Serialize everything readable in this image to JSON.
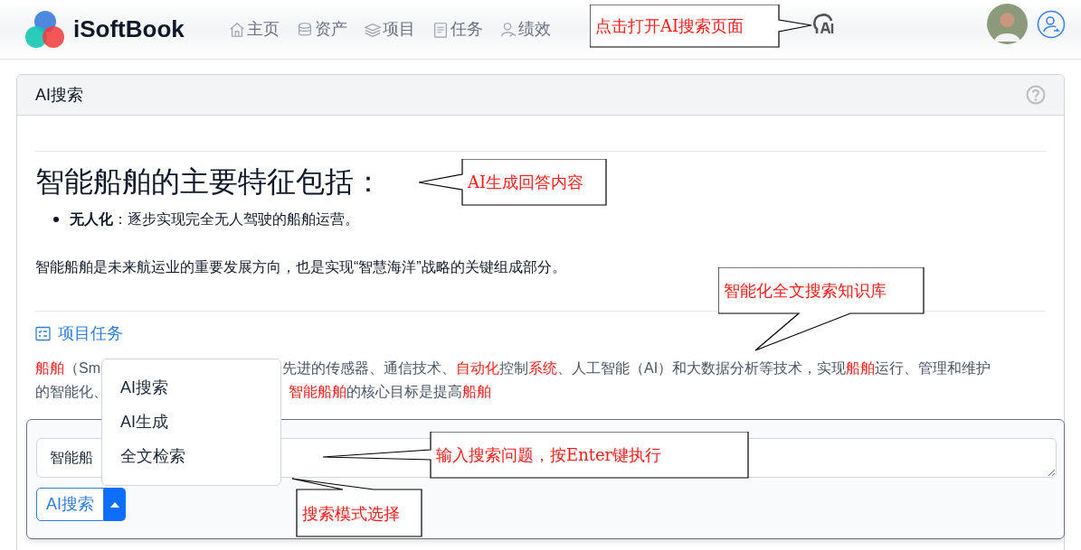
{
  "header": {
    "logo": "iSoftBook",
    "nav": [
      {
        "label": "主页"
      },
      {
        "label": "资产"
      },
      {
        "label": "项目"
      },
      {
        "label": "任务"
      },
      {
        "label": "绩效"
      }
    ]
  },
  "card": {
    "title": "AI搜索",
    "answer": {
      "heading": "智能船舶的主要特征包括：",
      "bullets": [
        "**无人化**：逐步实现完全无人驾驶的船舶运营。"
      ],
      "summary": "智能船舶是未来航运业的重要发展方向，也是实现“智慧海洋”战略的关键组成部分。"
    },
    "source": {
      "title": "项目任务",
      "lines": [
        {
          "left": [
            {
              "text": "船舶",
              "highlight": true
            },
            {
              "text": "（Sm",
              "highlight": false
            }
          ],
          "right": [
            {
              "text": "先进的传感器、通信技术、",
              "highlight": false
            },
            {
              "text": "自动化",
              "highlight": true
            },
            {
              "text": "控制",
              "highlight": false
            },
            {
              "text": "系统",
              "highlight": true
            },
            {
              "text": "、人工智能（AI）和大数据分析等技术，实现",
              "highlight": false
            },
            {
              "text": "船舶",
              "highlight": true
            },
            {
              "text": "运行、管理和维护",
              "highlight": false
            }
          ]
        },
        {
          "left": [
            {
              "text": "的智能化、",
              "highlight": false
            }
          ],
          "right": [
            {
              "text": "智能船舶",
              "highlight": true
            },
            {
              "text": "的核心目标是提高",
              "highlight": false
            },
            {
              "text": "船舶",
              "highlight": true
            }
          ]
        }
      ]
    }
  },
  "search": {
    "value": "智能船",
    "mode_button": "AI搜索",
    "menu": [
      "AI搜索",
      "AI生成",
      "全文检索"
    ]
  },
  "callouts": [
    "点击打开AI搜索页面",
    "AI生成回答内容",
    "智能化全文搜索知识库",
    "输入搜索问题，按Enter键执行",
    "搜索模式选择"
  ]
}
